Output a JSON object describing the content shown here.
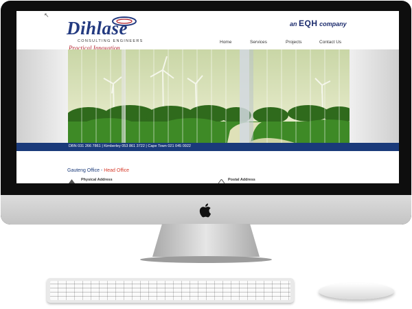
{
  "site": {
    "logo": {
      "name": "Dihlase",
      "subtitle": "CONSULTING ENGINEERS",
      "tagline": "Practical Innovation"
    },
    "parent": {
      "prefix": "an",
      "name": "EQH",
      "suffix": "company"
    },
    "nav": [
      {
        "label": "Home"
      },
      {
        "label": "Services"
      },
      {
        "label": "Projects"
      },
      {
        "label": "Contact Us"
      }
    ],
    "contact_bar": "DBN 031 266 7861  |  Kimberley 053 861 3722  |  Cape Town 021 045 0922",
    "office": {
      "title": "Gauteng Office",
      "separator": " - ",
      "highlight": "Head Office"
    },
    "addresses": [
      {
        "label": "Physical Address",
        "icon": "map-pin-icon"
      },
      {
        "label": "Postal Address",
        "icon": "envelope-icon"
      }
    ]
  },
  "colors": {
    "brand_blue": "#233a80",
    "tagline_red": "#b21e2a",
    "bar_navy": "#1a3a7a",
    "highlight_red": "#d63a2a",
    "bezel": "#0e0e0e"
  }
}
